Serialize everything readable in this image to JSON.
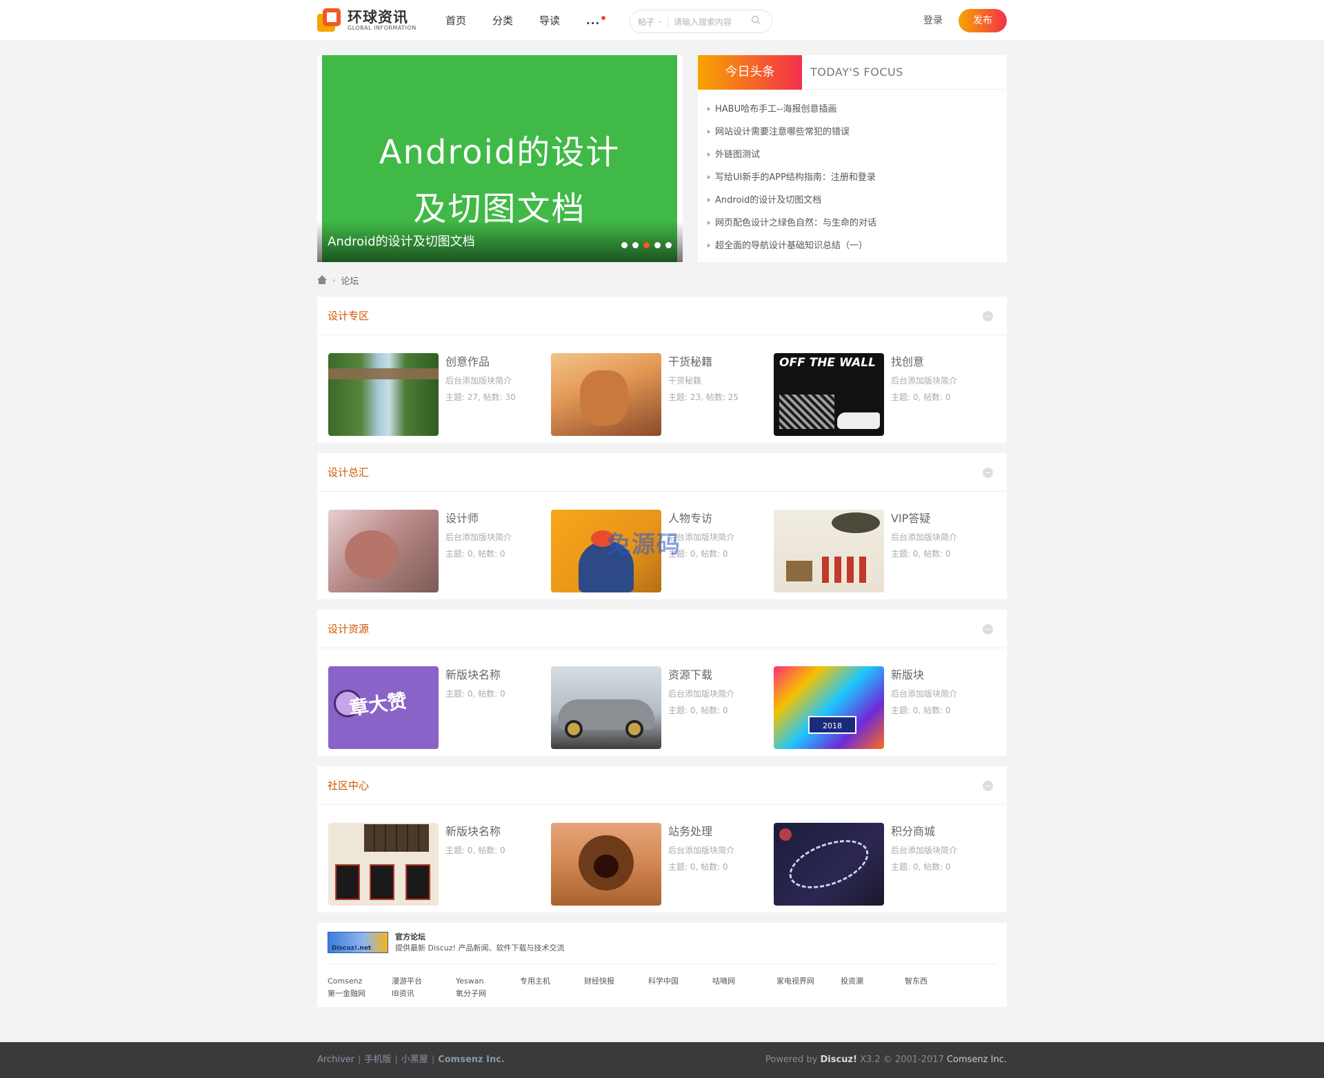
{
  "header": {
    "logo_cn": "环球资讯",
    "logo_en": "GLOBAL INFORMATION",
    "nav": [
      "首页",
      "分类",
      "导读"
    ],
    "nav_more": "...",
    "search_type": "帖子",
    "search_placeholder": "请输入搜索内容",
    "login": "登录",
    "publish": "发布"
  },
  "banner": {
    "slide_line1": "Android的设计",
    "slide_line2": "及切图文档",
    "caption": "Android的设计及切图文档",
    "slide_count": 5,
    "active_slide": 3,
    "colors": {
      "slide_bg": "#40b947",
      "accent": "#ee5a24"
    }
  },
  "focus": {
    "tab_label": "今日头条",
    "tab_en": "TODAY'S FOCUS",
    "items": [
      "HABU哈布手工--海报创意插画",
      "网站设计需要注意哪些常犯的错误",
      "外链图测试",
      "写给UI新手的APP结构指南：注册和登录",
      "Android的设计及切图文档",
      "网页配色设计之绿色自然：与生命的对话",
      "超全面的导航设计基础知识总结（一）"
    ]
  },
  "breadcrumb": {
    "current": "论坛"
  },
  "sections": [
    {
      "title": "设计专区",
      "forums": [
        {
          "name": "创意作品",
          "desc": "后台添加版块简介",
          "stat": "主题: 27, 帖数: 30"
        },
        {
          "name": "干货秘籍",
          "desc": "干货秘籍",
          "stat": "主题: 23, 帖数: 25"
        },
        {
          "name": "找创意",
          "desc": "后台添加版块简介",
          "stat": "主题: 0, 帖数: 0",
          "thumb_text": "OFF THE WALL"
        }
      ]
    },
    {
      "title": "设计总汇",
      "forums": [
        {
          "name": "设计师",
          "desc": "后台添加版块简介",
          "stat": "主题: 0, 帖数: 0"
        },
        {
          "name": "人物专访",
          "desc": "后台添加版块简介",
          "stat": "主题: 0, 帖数: 0"
        },
        {
          "name": "VIP答疑",
          "desc": "后台添加版块简介",
          "stat": "主题: 0, 帖数: 0"
        }
      ]
    },
    {
      "title": "设计资源",
      "forums": [
        {
          "name": "新版块名称",
          "stat": "主题: 0, 帖数: 0",
          "thumb_text": "章大赞"
        },
        {
          "name": "资源下载",
          "desc": "后台添加版块简介",
          "stat": "主题: 0, 帖数: 0"
        },
        {
          "name": "新版块",
          "desc": "后台添加版块简介",
          "stat": "主题: 0, 帖数: 0",
          "thumb_text": "2018"
        }
      ]
    },
    {
      "title": "社区中心",
      "forums": [
        {
          "name": "新版块名称",
          "stat": "主题: 0, 帖数: 0"
        },
        {
          "name": "站务处理",
          "desc": "后台添加版块简介",
          "stat": "主题: 0, 帖数: 0"
        },
        {
          "name": "积分商城",
          "desc": "后台添加版块简介",
          "stat": "主题: 0, 帖数: 0"
        }
      ]
    }
  ],
  "watermark": "兔源码",
  "links": {
    "official_logo": "Discuz!.net",
    "official_title": "官方论坛",
    "official_desc": "提供最新 Discuz! 产品新闻、软件下载与技术交流",
    "friends": [
      "Comsenz",
      "漫游平台",
      "Yeswan",
      "专用主机",
      "财经快报",
      "科学中国",
      "咕嘀网",
      "家电视界网",
      "投资潮",
      "智东西",
      "第一金融网",
      "IB资讯",
      "氧分子网"
    ]
  },
  "footer": {
    "left": [
      "Archiver",
      "手机版",
      "小黑屋",
      "Comsenz Inc."
    ],
    "powered_prefix": "Powered by",
    "powered_brand": "Discuz!",
    "version": "X3.2",
    "copyright": "© 2001-2017",
    "company": "Comsenz Inc."
  }
}
